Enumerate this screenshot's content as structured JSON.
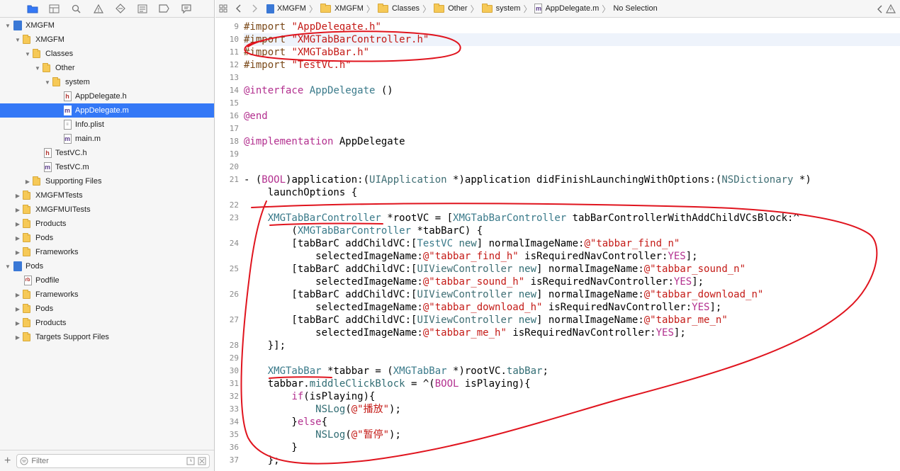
{
  "navigator": {
    "filter_placeholder": "Filter",
    "tree": [
      {
        "label": "XMGFM",
        "level": 0,
        "kind": "project",
        "expanded": true
      },
      {
        "label": "XMGFM",
        "level": 1,
        "kind": "folder",
        "expanded": true
      },
      {
        "label": "Classes",
        "level": 2,
        "kind": "folder",
        "expanded": true
      },
      {
        "label": "Other",
        "level": 3,
        "kind": "folder",
        "expanded": true
      },
      {
        "label": "system",
        "level": 4,
        "kind": "folder",
        "expanded": true
      },
      {
        "label": "AppDelegate.h",
        "level": 5,
        "kind": "h"
      },
      {
        "label": "AppDelegate.m",
        "level": 5,
        "kind": "m",
        "selected": true
      },
      {
        "label": "Info.plist",
        "level": 5,
        "kind": "plist"
      },
      {
        "label": "main.m",
        "level": 5,
        "kind": "m"
      },
      {
        "label": "TestVC.h",
        "level": 3,
        "kind": "h"
      },
      {
        "label": "TestVC.m",
        "level": 3,
        "kind": "m"
      },
      {
        "label": "Supporting Files",
        "level": 2,
        "kind": "folder",
        "expanded": false
      },
      {
        "label": "XMGFMTests",
        "level": 1,
        "kind": "folder",
        "expanded": false
      },
      {
        "label": "XMGFMUITests",
        "level": 1,
        "kind": "folder",
        "expanded": false
      },
      {
        "label": "Products",
        "level": 1,
        "kind": "folder",
        "expanded": false
      },
      {
        "label": "Pods",
        "level": 1,
        "kind": "folder",
        "expanded": false
      },
      {
        "label": "Frameworks",
        "level": 1,
        "kind": "folder",
        "expanded": false
      },
      {
        "label": "Pods",
        "level": 0,
        "kind": "project",
        "expanded": true
      },
      {
        "label": "Podfile",
        "level": 1,
        "kind": "rb"
      },
      {
        "label": "Frameworks",
        "level": 1,
        "kind": "folder",
        "expanded": false
      },
      {
        "label": "Pods",
        "level": 1,
        "kind": "folder",
        "expanded": false
      },
      {
        "label": "Products",
        "level": 1,
        "kind": "folder",
        "expanded": false
      },
      {
        "label": "Targets Support Files",
        "level": 1,
        "kind": "folder",
        "expanded": false
      }
    ]
  },
  "jumpbar": {
    "crumbs": [
      {
        "label": "XMGFM",
        "icon": "project"
      },
      {
        "label": "XMGFM",
        "icon": "folder"
      },
      {
        "label": "Classes",
        "icon": "folder"
      },
      {
        "label": "Other",
        "icon": "folder"
      },
      {
        "label": "system",
        "icon": "folder"
      },
      {
        "label": "AppDelegate.m",
        "icon": "m"
      },
      {
        "label": "No Selection",
        "icon": ""
      }
    ]
  },
  "editor": {
    "highlighted_line": 10,
    "lines": [
      {
        "n": "9",
        "html": "<span class=\"pp\">#import </span><span class=\"str\">\"AppDelegate.h\"</span>"
      },
      {
        "n": "10",
        "html": "<span class=\"pp\">#import </span><span class=\"str\">\"XMGTabBarController.h\"</span>"
      },
      {
        "n": "11",
        "html": "<span class=\"pp\">#import </span><span class=\"str\">\"XMGTabBar.h\"</span>"
      },
      {
        "n": "12",
        "html": "<span class=\"pp\">#import </span><span class=\"str\">\"TestVC.h\"</span>"
      },
      {
        "n": "13",
        "html": ""
      },
      {
        "n": "14",
        "html": "<span class=\"kw\">@interface</span> <span class=\"cls\">AppDelegate</span> ()"
      },
      {
        "n": "15",
        "html": ""
      },
      {
        "n": "16",
        "html": "<span class=\"kw\">@end</span>"
      },
      {
        "n": "17",
        "html": ""
      },
      {
        "n": "18",
        "html": "<span class=\"kw\">@implementation</span> AppDelegate"
      },
      {
        "n": "19",
        "html": ""
      },
      {
        "n": "20",
        "html": ""
      },
      {
        "n": "21",
        "html": "- (<span class=\"kw\">BOOL</span>)application:(<span class=\"typ\">UIApplication</span> *)application didFinishLaunchingWithOptions:(<span class=\"typ\">NSDictionary</span> *)"
      },
      {
        "n": "",
        "html": "    launchOptions {"
      },
      {
        "n": "22",
        "html": ""
      },
      {
        "n": "23",
        "html": "    <span class=\"cls\">XMGTabBarController</span> *rootVC = [<span class=\"cls\">XMGTabBarController</span> tabBarControllerWithAddChildVCsBlock:^"
      },
      {
        "n": "",
        "html": "        (<span class=\"cls\">XMGTabBarController</span> *tabBarC) {"
      },
      {
        "n": "24",
        "html": "        [tabBarC addChildVC:[<span class=\"cls\">TestVC</span> <span class=\"meth\">new</span>] normalImageName:<span class=\"nslit\">@\"tabbar_find_n\"</span>"
      },
      {
        "n": "",
        "html": "            selectedImageName:<span class=\"nslit\">@\"tabbar_find_h\"</span> isRequiredNavController:<span class=\"kw\">YES</span>];"
      },
      {
        "n": "25",
        "html": "        [tabBarC addChildVC:[<span class=\"typ\">UIViewController</span> <span class=\"meth\">new</span>] normalImageName:<span class=\"nslit\">@\"tabbar_sound_n\"</span>"
      },
      {
        "n": "",
        "html": "            selectedImageName:<span class=\"nslit\">@\"tabbar_sound_h\"</span> isRequiredNavController:<span class=\"kw\">YES</span>];"
      },
      {
        "n": "26",
        "html": "        [tabBarC addChildVC:[<span class=\"typ\">UIViewController</span> <span class=\"meth\">new</span>] normalImageName:<span class=\"nslit\">@\"tabbar_download_n\"</span>"
      },
      {
        "n": "",
        "html": "            selectedImageName:<span class=\"nslit\">@\"tabbar_download_h\"</span> isRequiredNavController:<span class=\"kw\">YES</span>];"
      },
      {
        "n": "27",
        "html": "        [tabBarC addChildVC:[<span class=\"typ\">UIViewController</span> <span class=\"meth\">new</span>] normalImageName:<span class=\"nslit\">@\"tabbar_me_n\"</span>"
      },
      {
        "n": "",
        "html": "            selectedImageName:<span class=\"nslit\">@\"tabbar_me_h\"</span> isRequiredNavController:<span class=\"kw\">YES</span>];"
      },
      {
        "n": "28",
        "html": "    }];"
      },
      {
        "n": "29",
        "html": ""
      },
      {
        "n": "30",
        "html": "    <span class=\"cls\">XMGTabBar</span> *tabbar = (<span class=\"cls\">XMGTabBar</span> *)rootVC.<span class=\"meth\">tabBar</span>;"
      },
      {
        "n": "31",
        "html": "    tabbar.<span class=\"meth\">middleClickBlock</span> = ^(<span class=\"kw\">BOOL</span> isPlaying){"
      },
      {
        "n": "32",
        "html": "        <span class=\"kw\">if</span>(isPlaying){"
      },
      {
        "n": "33",
        "html": "            <span class=\"meth\">NSLog</span>(<span class=\"nslit\">@\"播放\"</span>);"
      },
      {
        "n": "34",
        "html": "        }<span class=\"kw\">else</span>{"
      },
      {
        "n": "35",
        "html": "            <span class=\"meth\">NSLog</span>(<span class=\"nslit\">@\"暂停\"</span>);"
      },
      {
        "n": "36",
        "html": "        }"
      },
      {
        "n": "37",
        "html": "    };"
      }
    ]
  },
  "colors": {
    "selection": "#3478f6",
    "annotation": "#e0141e",
    "folder": "#f6c957"
  }
}
